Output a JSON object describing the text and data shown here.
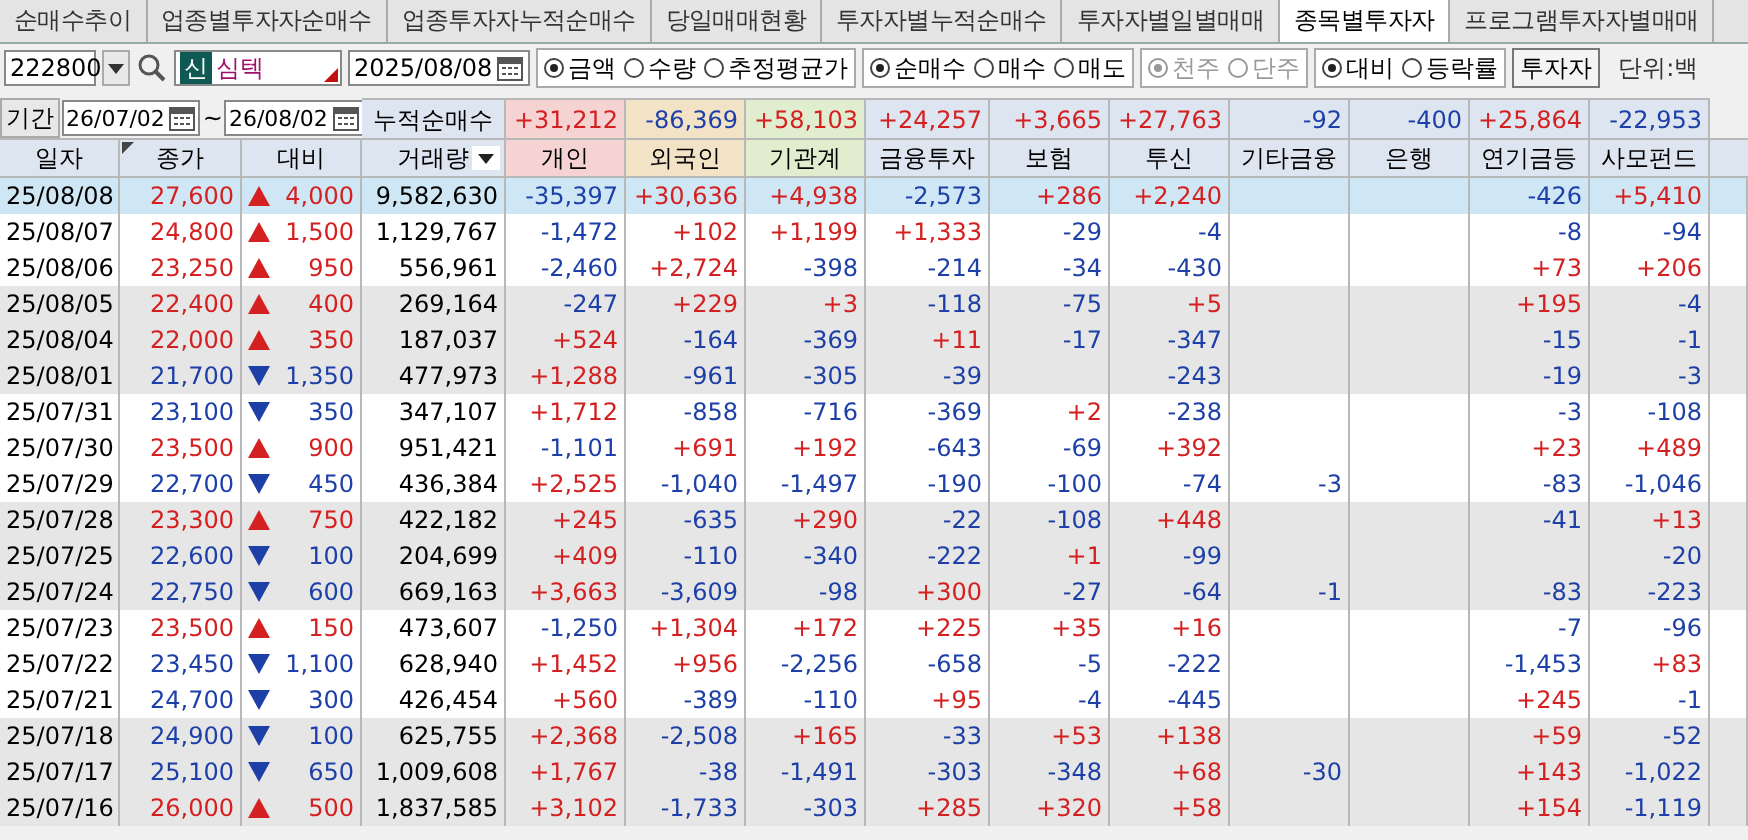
{
  "tabs": [
    {
      "label": "순매수추이",
      "selected": false
    },
    {
      "label": "업종별투자자순매수",
      "selected": false
    },
    {
      "label": "업종투자자누적순매수",
      "selected": false
    },
    {
      "label": "당일매매현황",
      "selected": false
    },
    {
      "label": "투자자별누적순매수",
      "selected": false
    },
    {
      "label": "투자자별일별매매",
      "selected": false
    },
    {
      "label": "종목별투자자",
      "selected": true
    },
    {
      "label": "프로그램투자자별매매",
      "selected": false
    }
  ],
  "toolbar": {
    "stock_code": "222800",
    "market_badge": "신",
    "stock_name": "심텍",
    "date": "2025/08/08",
    "radio_groups": [
      {
        "options": [
          {
            "label": "금액",
            "selected": true,
            "disabled": false
          },
          {
            "label": "수량",
            "selected": false,
            "disabled": false
          },
          {
            "label": "추정평균가",
            "selected": false,
            "disabled": false
          }
        ]
      },
      {
        "options": [
          {
            "label": "순매수",
            "selected": true,
            "disabled": false
          },
          {
            "label": "매수",
            "selected": false,
            "disabled": false
          },
          {
            "label": "매도",
            "selected": false,
            "disabled": false
          }
        ]
      },
      {
        "options": [
          {
            "label": "천주",
            "selected": true,
            "disabled": true
          },
          {
            "label": "단주",
            "selected": false,
            "disabled": true
          }
        ]
      },
      {
        "options": [
          {
            "label": "대비",
            "selected": true,
            "disabled": false
          },
          {
            "label": "등락률",
            "selected": false,
            "disabled": false
          }
        ]
      }
    ],
    "investor_button": "투자자",
    "unit_label": "단위:백"
  },
  "period": {
    "label": "기간",
    "start": "26/07/02",
    "separator": "~",
    "end": "26/08/02"
  },
  "table": {
    "summary_label": "누적순매수",
    "summary_values": [
      "+31,212",
      "-86,369",
      "+58,103",
      "+24,257",
      "+3,665",
      "+27,763",
      "-92",
      "-400",
      "+25,864",
      "-22,953"
    ],
    "columns": [
      {
        "label": "일자",
        "kind": "plain",
        "color": "#dde6f0"
      },
      {
        "label": "종가",
        "kind": "sorted",
        "color": "#dde6f0"
      },
      {
        "label": "대비",
        "kind": "plain",
        "color": "#dde6f0"
      },
      {
        "label": "거래량",
        "kind": "menu",
        "color": "#dde6f0"
      },
      {
        "label": "개인",
        "kind": "plain",
        "color": "#f6d3d3"
      },
      {
        "label": "외국인",
        "kind": "plain",
        "color": "#f2e2c6"
      },
      {
        "label": "기관계",
        "kind": "plain",
        "color": "#e0edcf"
      },
      {
        "label": "금융투자",
        "kind": "plain",
        "color": "#dde6f0"
      },
      {
        "label": "보험",
        "kind": "plain",
        "color": "#dde6f0"
      },
      {
        "label": "투신",
        "kind": "plain",
        "color": "#dde6f0"
      },
      {
        "label": "기타금융",
        "kind": "plain",
        "color": "#dde6f0"
      },
      {
        "label": "은행",
        "kind": "plain",
        "color": "#dde6f0"
      },
      {
        "label": "연기금등",
        "kind": "plain",
        "color": "#dde6f0"
      },
      {
        "label": "사모펀드",
        "kind": "plain",
        "color": "#dde6f0"
      }
    ],
    "rows": [
      {
        "date": "25/08/08",
        "close": "27,600",
        "rising": true,
        "change": "4,000",
        "volume": "9,582,630",
        "values": {
          "individual": "-35,397",
          "foreign": "+30,636",
          "institutions": "+4,938",
          "financial_investment": "-2,573",
          "insurance": "+286",
          "investment_trust": "+2,240",
          "pension": "-426",
          "private_fund": "+5,410"
        },
        "selected": true
      },
      {
        "date": "25/08/07",
        "close": "24,800",
        "rising": true,
        "change": "1,500",
        "volume": "1,129,767",
        "values": {
          "individual": "-1,472",
          "foreign": "+102",
          "institutions": "+1,199",
          "financial_investment": "+1,333",
          "insurance": "-29",
          "investment_trust": "-4",
          "pension": "-8",
          "private_fund": "-94"
        },
        "selected": false
      },
      {
        "date": "25/08/06",
        "close": "23,250",
        "rising": true,
        "change": "950",
        "volume": "556,961",
        "values": {
          "individual": "-2,460",
          "foreign": "+2,724",
          "institutions": "-398",
          "financial_investment": "-214",
          "insurance": "-34",
          "investment_trust": "-430",
          "pension": "+73",
          "private_fund": "+206"
        },
        "selected": false
      },
      {
        "date": "25/08/05",
        "close": "22,400",
        "rising": true,
        "change": "400",
        "volume": "269,164",
        "values": {
          "individual": "-247",
          "foreign": "+229",
          "institutions": "+3",
          "financial_investment": "-118",
          "insurance": "-75",
          "investment_trust": "+5",
          "pension": "+195",
          "private_fund": "-4"
        },
        "selected": false
      },
      {
        "date": "25/08/04",
        "close": "22,000",
        "rising": true,
        "change": "350",
        "volume": "187,037",
        "values": {
          "individual": "+524",
          "foreign": "-164",
          "institutions": "-369",
          "financial_investment": "+11",
          "insurance": "-17",
          "investment_trust": "-347",
          "pension": "-15",
          "private_fund": "-1"
        },
        "selected": false
      },
      {
        "date": "25/08/01",
        "close": "21,700",
        "rising": false,
        "change": "1,350",
        "volume": "477,973",
        "values": {
          "individual": "+1,288",
          "foreign": "-961",
          "institutions": "-305",
          "financial_investment": "-39",
          "investment_trust": "-243",
          "pension": "-19",
          "private_fund": "-3"
        },
        "selected": false
      },
      {
        "date": "25/07/31",
        "close": "23,100",
        "rising": false,
        "change": "350",
        "volume": "347,107",
        "values": {
          "individual": "+1,712",
          "foreign": "-858",
          "institutions": "-716",
          "financial_investment": "-369",
          "insurance": "+2",
          "investment_trust": "-238",
          "pension": "-3",
          "private_fund": "-108"
        },
        "selected": false
      },
      {
        "date": "25/07/30",
        "close": "23,500",
        "rising": true,
        "change": "900",
        "volume": "951,421",
        "values": {
          "individual": "-1,101",
          "foreign": "+691",
          "institutions": "+192",
          "financial_investment": "-643",
          "insurance": "-69",
          "investment_trust": "+392",
          "pension": "+23",
          "private_fund": "+489"
        },
        "selected": false
      },
      {
        "date": "25/07/29",
        "close": "22,700",
        "rising": false,
        "change": "450",
        "volume": "436,384",
        "values": {
          "individual": "+2,525",
          "foreign": "-1,040",
          "institutions": "-1,497",
          "financial_investment": "-190",
          "insurance": "-100",
          "investment_trust": "-74",
          "other_finance": "-3",
          "pension": "-83",
          "private_fund": "-1,046"
        },
        "selected": false
      },
      {
        "date": "25/07/28",
        "close": "23,300",
        "rising": true,
        "change": "750",
        "volume": "422,182",
        "values": {
          "individual": "+245",
          "foreign": "-635",
          "institutions": "+290",
          "financial_investment": "-22",
          "insurance": "-108",
          "investment_trust": "+448",
          "pension": "-41",
          "private_fund": "+13"
        },
        "selected": false
      },
      {
        "date": "25/07/25",
        "close": "22,600",
        "rising": false,
        "change": "100",
        "volume": "204,699",
        "values": {
          "individual": "+409",
          "foreign": "-110",
          "institutions": "-340",
          "financial_investment": "-222",
          "insurance": "+1",
          "investment_trust": "-99",
          "private_fund": "-20"
        },
        "selected": false
      },
      {
        "date": "25/07/24",
        "close": "22,750",
        "rising": false,
        "change": "600",
        "volume": "669,163",
        "values": {
          "individual": "+3,663",
          "foreign": "-3,609",
          "institutions": "-98",
          "financial_investment": "+300",
          "insurance": "-27",
          "investment_trust": "-64",
          "other_finance": "-1",
          "pension": "-83",
          "private_fund": "-223"
        },
        "selected": false
      },
      {
        "date": "25/07/23",
        "close": "23,500",
        "rising": true,
        "change": "150",
        "volume": "473,607",
        "values": {
          "individual": "-1,250",
          "foreign": "+1,304",
          "institutions": "+172",
          "financial_investment": "+225",
          "insurance": "+35",
          "investment_trust": "+16",
          "pension": "-7",
          "private_fund": "-96"
        },
        "selected": false
      },
      {
        "date": "25/07/22",
        "close": "23,450",
        "rising": false,
        "change": "1,100",
        "volume": "628,940",
        "values": {
          "individual": "+1,452",
          "foreign": "+956",
          "institutions": "-2,256",
          "financial_investment": "-658",
          "insurance": "-5",
          "investment_trust": "-222",
          "pension": "-1,453",
          "private_fund": "+83"
        },
        "selected": false
      },
      {
        "date": "25/07/21",
        "close": "24,700",
        "rising": false,
        "change": "300",
        "volume": "426,454",
        "values": {
          "individual": "+560",
          "foreign": "-389",
          "institutions": "-110",
          "financial_investment": "+95",
          "insurance": "-4",
          "investment_trust": "-445",
          "pension": "+245",
          "private_fund": "-1"
        },
        "selected": false
      },
      {
        "date": "25/07/18",
        "close": "24,900",
        "rising": false,
        "change": "100",
        "volume": "625,755",
        "values": {
          "individual": "+2,368",
          "foreign": "-2,508",
          "institutions": "+165",
          "financial_investment": "-33",
          "insurance": "+53",
          "investment_trust": "+138",
          "pension": "+59",
          "private_fund": "-52"
        },
        "selected": false
      },
      {
        "date": "25/07/17",
        "close": "25,100",
        "rising": false,
        "change": "650",
        "volume": "1,009,608",
        "values": {
          "individual": "+1,767",
          "foreign": "-38",
          "institutions": "-1,491",
          "financial_investment": "-303",
          "insurance": "-348",
          "investment_trust": "+68",
          "other_finance": "-30",
          "pension": "+143",
          "private_fund": "-1,022"
        },
        "selected": false
      },
      {
        "date": "25/07/16",
        "close": "26,000",
        "rising": true,
        "change": "500",
        "volume": "1,837,585",
        "values": {
          "individual": "+3,102",
          "foreign": "-1,733",
          "institutions": "-303",
          "financial_investment": "+285",
          "insurance": "+320",
          "investment_trust": "+58",
          "pension": "+154",
          "private_fund": "-1,119"
        },
        "selected": false
      }
    ]
  }
}
